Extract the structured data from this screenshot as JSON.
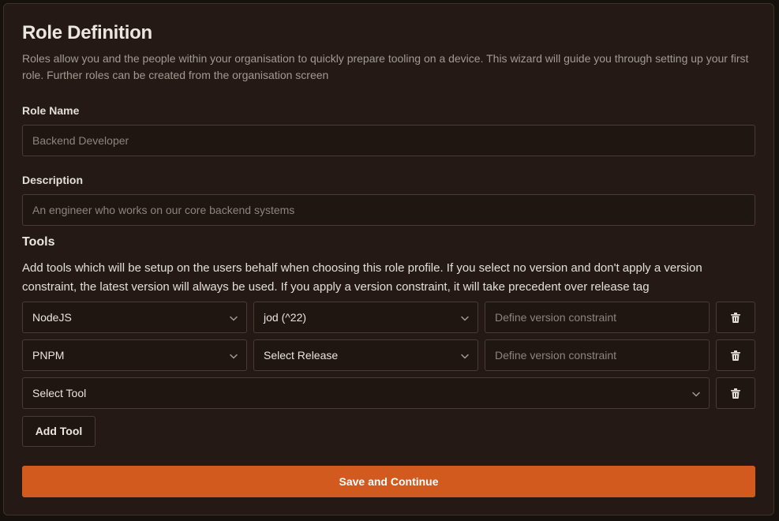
{
  "header": {
    "title": "Role Definition",
    "intro": "Roles allow you and the people within your organisation to quickly prepare tooling on a device. This wizard will guide you through setting up your first role. Further roles can be created from the organisation screen"
  },
  "form": {
    "role_name_label": "Role Name",
    "role_name_placeholder": "Backend Developer",
    "description_label": "Description",
    "description_placeholder": "An engineer who works on our core backend systems"
  },
  "tools": {
    "heading": "Tools",
    "help": "Add tools which will be setup on the users behalf when choosing this role profile. If you select no version and don't apply a version constraint, the latest version will always be used. If you apply a version constraint, it will take precedent over release tag",
    "rows": [
      {
        "tool": "NodeJS",
        "release": "jod (^22)",
        "constraint_placeholder": "Define version constraint"
      },
      {
        "tool": "PNPM",
        "release": "Select Release",
        "constraint_placeholder": "Define version constraint"
      },
      {
        "tool": "Select Tool"
      }
    ],
    "add_label": "Add Tool"
  },
  "actions": {
    "save_label": "Save and Continue"
  },
  "colors": {
    "accent": "#d35a1e",
    "background": "#241914",
    "border": "#4a3c33"
  },
  "icons": {
    "dropdown": "chevron-down-icon",
    "remove": "trash-icon"
  }
}
